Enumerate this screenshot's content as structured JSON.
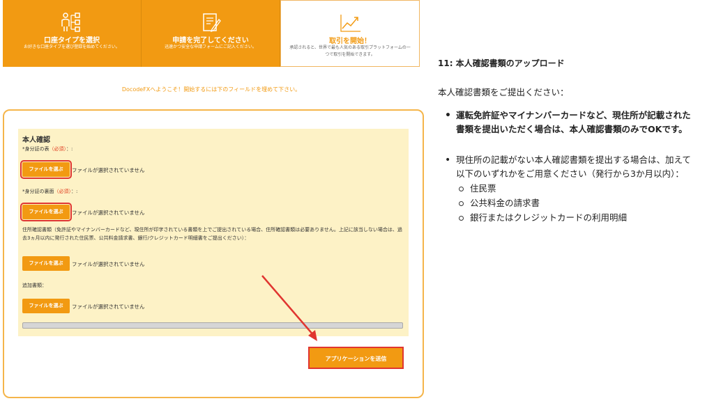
{
  "steps": [
    {
      "title": "口座タイプを選択",
      "desc": "お好きな口座タイプを選び登録を始めてください。"
    },
    {
      "title": "申請を完了してください",
      "desc": "迅速かつ安全な申請フォームにご記入ください。"
    },
    {
      "title": "取引を開始！",
      "desc": "承認されると、世界で最も人気のある取引プラットフォームの一つで取引を開始できます。"
    }
  ],
  "welcome": "DocodeFXへようこそ！開始するには下のフィールドを埋めて下さい。",
  "form": {
    "heading": "本人確認",
    "id_front_label": "*身分証の表",
    "id_back_label": "*身分証の裏面",
    "required_text": "（必須）",
    "suffix": "：:",
    "file_button": "ファイルを選ぶ",
    "no_file": "ファイルが選択されていません",
    "address_note": "住所確認書類（免許証やマイナンバーカードなど、現住所が印字されている書類を上でご提出されている場合、住所確認書類は必要ありません。上記に該当しない場合は、過去3ヵ月以内に発行された住民票、公共料金請求書、銀行/クレジットカード明細書をご提出ください）：",
    "additional_label": "追加書類：",
    "submit": "アプリケーションを送信"
  },
  "article": {
    "heading": "11:  本人確認書類のアップロード",
    "intro": "本人確認書類をご提出ください：",
    "bullet1": "運転免許証やマイナンバーカードなど、現住所が記載された書類を提出いただく場合は、本人確認書類のみでOKです。",
    "bullet2": "現住所の記載がない本人確認書類を提出する場合は、加えて以下のいずれかをご用意ください（発行から3か月以内）：",
    "sub_items": [
      "住民票",
      "公共料金の請求書",
      "銀行またはクレジットカードの利用明細"
    ]
  },
  "colors": {
    "brand_orange": "#f29a12",
    "highlight_red": "#e03530"
  },
  "icons": [
    "user-flow-icon",
    "form-edit-icon",
    "growth-chart-icon"
  ]
}
